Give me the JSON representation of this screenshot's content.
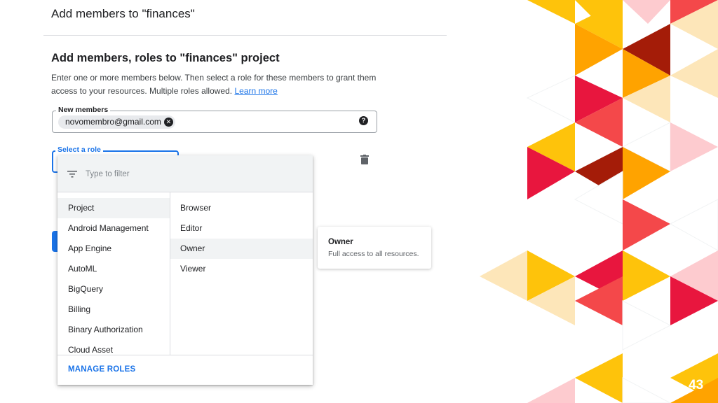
{
  "dialog": {
    "header_title": "Add members to \"finances\"",
    "section_title": "Add members, roles to \"finances\" project",
    "description": "Enter one or more members below. Then select a role for these members to grant them access to your resources. Multiple roles allowed.",
    "learn_more": "Learn more"
  },
  "members": {
    "label": "New members",
    "chips": [
      "novomembro@gmail.com"
    ]
  },
  "role_select": {
    "label": "Select a role"
  },
  "dropdown": {
    "filter_placeholder": "Type to filter",
    "categories": [
      "Project",
      "Android Management",
      "App Engine",
      "AutoML",
      "BigQuery",
      "Billing",
      "Binary Authorization",
      "Cloud Asset"
    ],
    "selected_category": "Project",
    "roles": [
      "Browser",
      "Editor",
      "Owner",
      "Viewer"
    ],
    "hovered_role": "Owner",
    "manage_roles": "MANAGE ROLES"
  },
  "tooltip": {
    "title": "Owner",
    "description": "Full access to all resources."
  },
  "slide": {
    "number": "43"
  },
  "colors": {
    "accent": "#1a73e8",
    "red": "#e8163e",
    "yellow": "#fec30b",
    "orange": "#ffa300",
    "dark_red": "#a41c08",
    "coral": "#f4484a",
    "pink": "#fdcbcf",
    "cream": "#fde6b9"
  }
}
